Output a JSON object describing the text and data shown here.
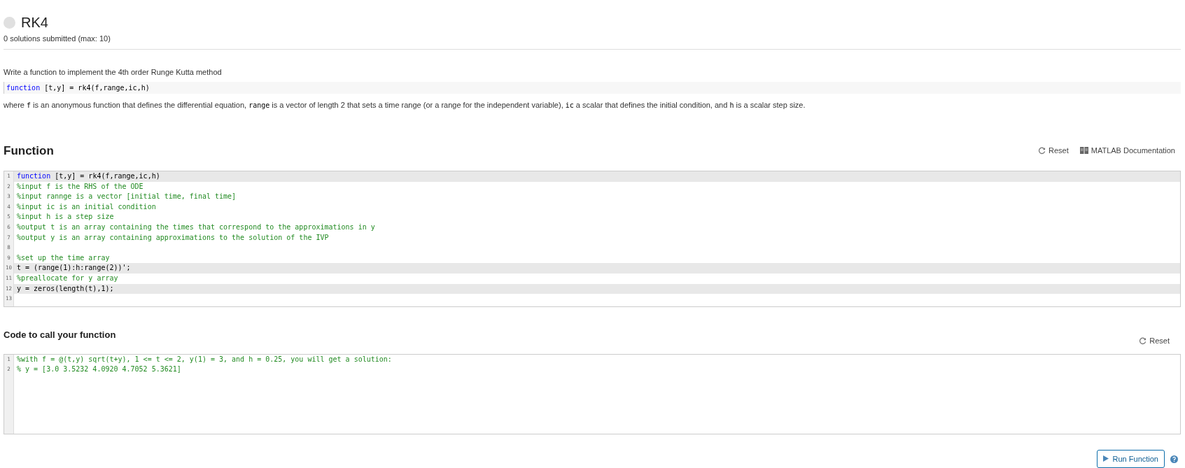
{
  "problem": {
    "title": "RK4",
    "solved": false,
    "submissions": "0 solutions submitted (max: 10)"
  },
  "description": {
    "intro": "Write a function to implement the 4th order Runge Kutta method",
    "signature": [
      {
        "kind": "keyword",
        "text": "function"
      },
      {
        "kind": "code",
        "text": " [t,y] = rk4(f,range,ic,h)"
      }
    ],
    "details": [
      {
        "kind": "text",
        "text": "where "
      },
      {
        "kind": "code",
        "text": "f"
      },
      {
        "kind": "text",
        "text": " is an anonymous function that defines the differential equation, "
      },
      {
        "kind": "code",
        "text": "range"
      },
      {
        "kind": "text",
        "text": " is a vector of length 2 that sets a time range (or a range for the independent variable), "
      },
      {
        "kind": "code",
        "text": "ic"
      },
      {
        "kind": "text",
        "text": " a scalar that defines the initial condition, and "
      },
      {
        "kind": "code",
        "text": "h"
      },
      {
        "kind": "text",
        "text": " is a scalar step size."
      }
    ]
  },
  "function_section": {
    "heading": "Function",
    "reset": "Reset",
    "docs": "MATLAB Documentation",
    "lines": [
      {
        "number": "1",
        "highlighted": true,
        "segments": [
          {
            "kind": "keyword",
            "text": "function"
          },
          {
            "kind": "code",
            "text": " [t,y] = rk4(f,range,ic,h)"
          }
        ]
      },
      {
        "number": "2",
        "highlighted": false,
        "segments": [
          {
            "kind": "comment",
            "text": "%input f is the RHS of the ODE"
          }
        ]
      },
      {
        "number": "3",
        "highlighted": false,
        "segments": [
          {
            "kind": "comment",
            "text": "%input rannge is a vector [initial time, final time]"
          }
        ]
      },
      {
        "number": "4",
        "highlighted": false,
        "segments": [
          {
            "kind": "comment",
            "text": "%input ic is an initial condition"
          }
        ]
      },
      {
        "number": "5",
        "highlighted": false,
        "segments": [
          {
            "kind": "comment",
            "text": "%input h is a step size"
          }
        ]
      },
      {
        "number": "6",
        "highlighted": false,
        "segments": [
          {
            "kind": "comment",
            "text": "%output t is an array containing the times that correspond to the approximations in y"
          }
        ]
      },
      {
        "number": "7",
        "highlighted": false,
        "segments": [
          {
            "kind": "comment",
            "text": "%output y is an array containing approximations to the solution of the IVP"
          }
        ]
      },
      {
        "number": "8",
        "highlighted": false
      },
      {
        "number": "9",
        "highlighted": false,
        "segments": [
          {
            "kind": "comment",
            "text": "%set up the time array"
          }
        ]
      },
      {
        "number": "10",
        "highlighted": true,
        "segments": [
          {
            "kind": "code",
            "text": "t = (range(1):h:range(2))';"
          }
        ]
      },
      {
        "number": "11",
        "highlighted": false,
        "segments": [
          {
            "kind": "comment",
            "text": "%preallocate for y array"
          }
        ]
      },
      {
        "number": "12",
        "highlighted": true,
        "segments": [
          {
            "kind": "code",
            "text": "y = zeros(length(t),1);"
          }
        ]
      },
      {
        "number": "13",
        "highlighted": false
      }
    ]
  },
  "call_section": {
    "heading": "Code to call your function",
    "reset": "Reset",
    "lines": [
      {
        "number": "1",
        "highlighted": false,
        "segments": [
          {
            "kind": "comment",
            "text": "%with f = @(t,y) sqrt(t+y), 1 <= t <= 2, y(1) = 3, and h = 0.25, you will get a solution:"
          }
        ]
      },
      {
        "number": "2",
        "highlighted": false,
        "segments": [
          {
            "kind": "comment",
            "text": "% y = [3.0 3.5232 4.0920 4.7052 5.3621]"
          }
        ]
      }
    ]
  },
  "run_button": "Run Function"
}
